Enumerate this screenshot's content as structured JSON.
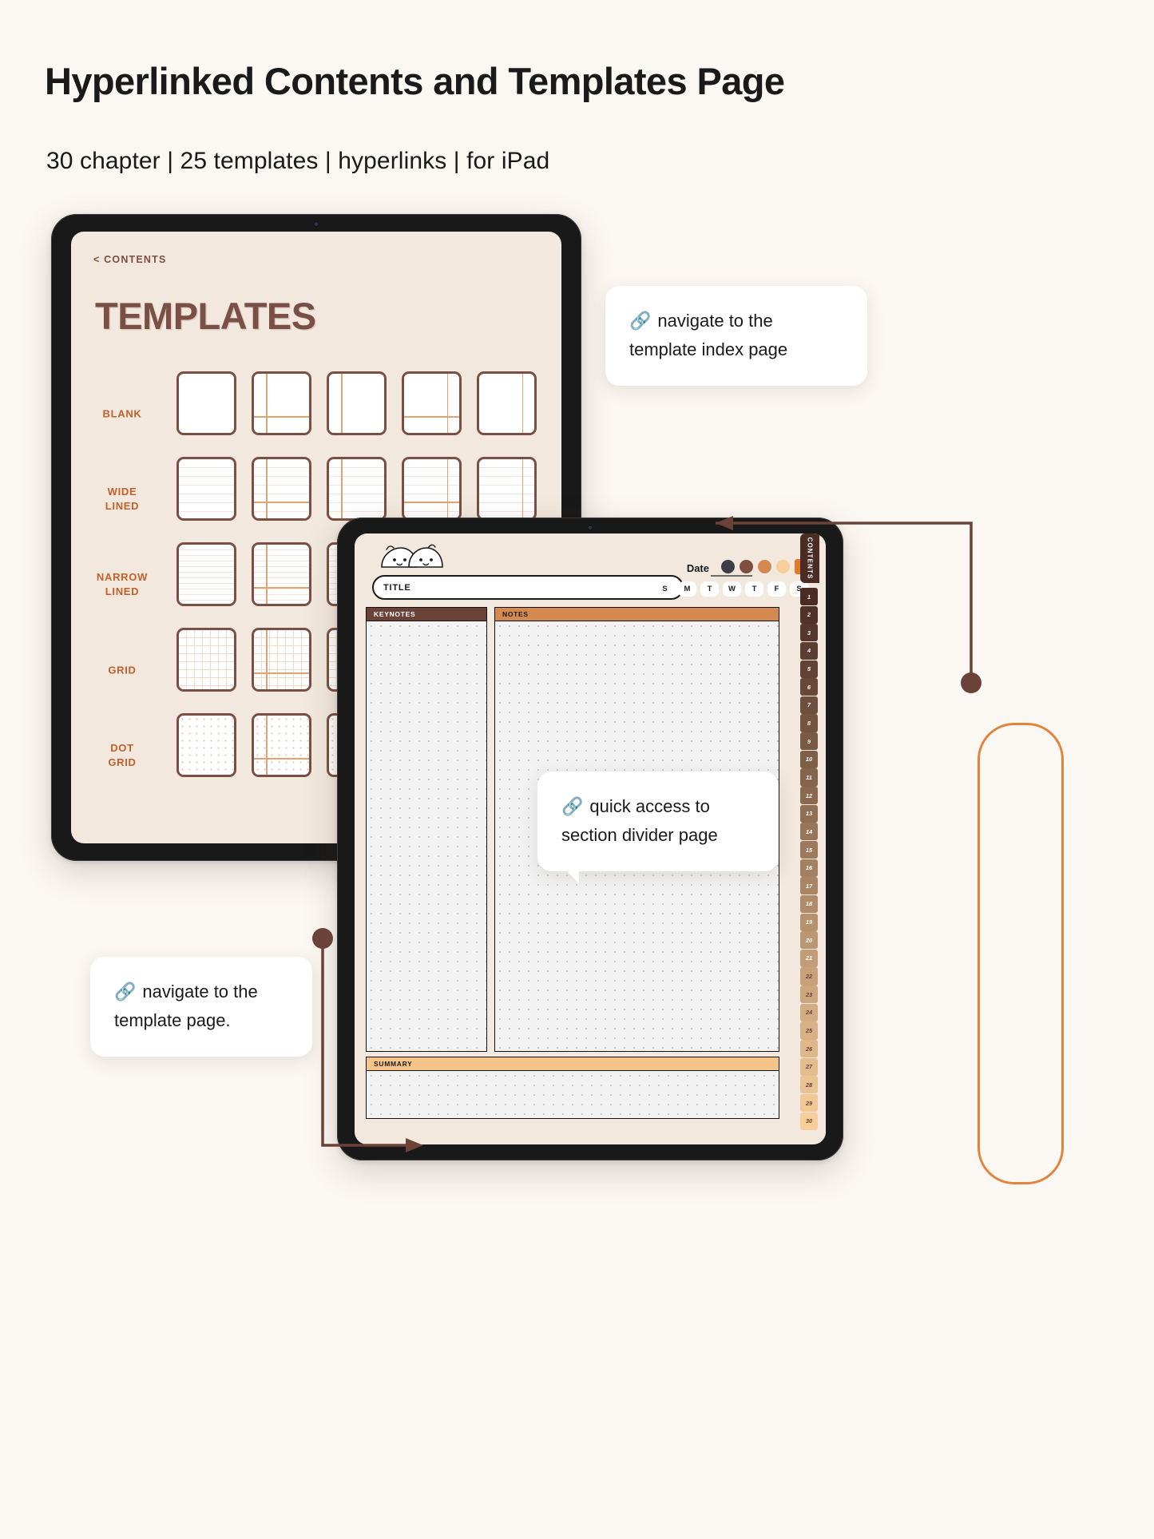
{
  "header": {
    "title": "Hyperlinked Contents and Templates Page",
    "subtitle": "30 chapter | 25 templates | hyperlinks | for iPad"
  },
  "colors": {
    "page_bg": "#fbf7f2",
    "screen_bg": "#f2e8dd",
    "brown_dark": "#6b4238",
    "brown_heading": "#7a4f45",
    "orange_label": "#c1602b",
    "orange_accent": "#d4894f",
    "orange_highlight": "#e08440",
    "summary_band": "#f6c488"
  },
  "tablet_templates": {
    "back_link": "< CONTENTS",
    "heading": "TEMPLATES",
    "rows": [
      {
        "label": "BLANK",
        "pattern": "blank",
        "thumbs": [
          "plain",
          "split-left-bottom",
          "split-left",
          "split-bottom",
          "split-right"
        ]
      },
      {
        "label": "WIDE\nLINED",
        "pattern": "wide",
        "thumbs": [
          "plain",
          "split-left-bottom",
          "split-left",
          "split-bottom",
          "split-right"
        ]
      },
      {
        "label": "NARROW\nLINED",
        "pattern": "narrow",
        "thumbs": [
          "plain",
          "split-left-bottom",
          "split-left",
          "split-bottom",
          "split-right"
        ]
      },
      {
        "label": "GRID",
        "pattern": "grid",
        "thumbs": [
          "plain",
          "split-left-bottom",
          "split-left",
          "split-bottom",
          "split-right"
        ]
      },
      {
        "label": "DOT\nGRID",
        "pattern": "dot",
        "thumbs": [
          "plain",
          "split-left-bottom",
          "split-left",
          "split-bottom",
          "split-right"
        ]
      }
    ]
  },
  "tablet_notes": {
    "title_field": {
      "value": "TITLE",
      "placeholder": "TITLE"
    },
    "date_label": "Date",
    "swatches": [
      {
        "name": "charcoal",
        "color": "#3d3d48",
        "selected": false
      },
      {
        "name": "brown",
        "color": "#7d4f3c",
        "selected": false
      },
      {
        "name": "tan",
        "color": "#d4884f",
        "selected": false
      },
      {
        "name": "peach",
        "color": "#f6cf9a",
        "selected": false
      },
      {
        "name": "orange",
        "color": "#e07b2c",
        "selected": true
      }
    ],
    "weekdays": [
      "S",
      "M",
      "T",
      "W",
      "T",
      "F",
      "S"
    ],
    "panels": {
      "keynotes": "KEYNOTES",
      "notes": "NOTES",
      "summary": "SUMMARY"
    },
    "contents_tab": "CONTENTS",
    "page_numbers": [
      1,
      2,
      3,
      4,
      5,
      6,
      7,
      8,
      9,
      10,
      11,
      12,
      13,
      14,
      15,
      16,
      17,
      18,
      19,
      20,
      21,
      22,
      23,
      24,
      25,
      26,
      27,
      28,
      29,
      30
    ]
  },
  "callouts": [
    {
      "icon": "link-icon",
      "lines": [
        "navigate to the",
        "template index page"
      ]
    },
    {
      "icon": "link-icon",
      "lines": [
        "quick access to",
        "section divider page"
      ]
    },
    {
      "icon": "link-icon",
      "lines": [
        "navigate to the",
        "template page."
      ]
    }
  ]
}
